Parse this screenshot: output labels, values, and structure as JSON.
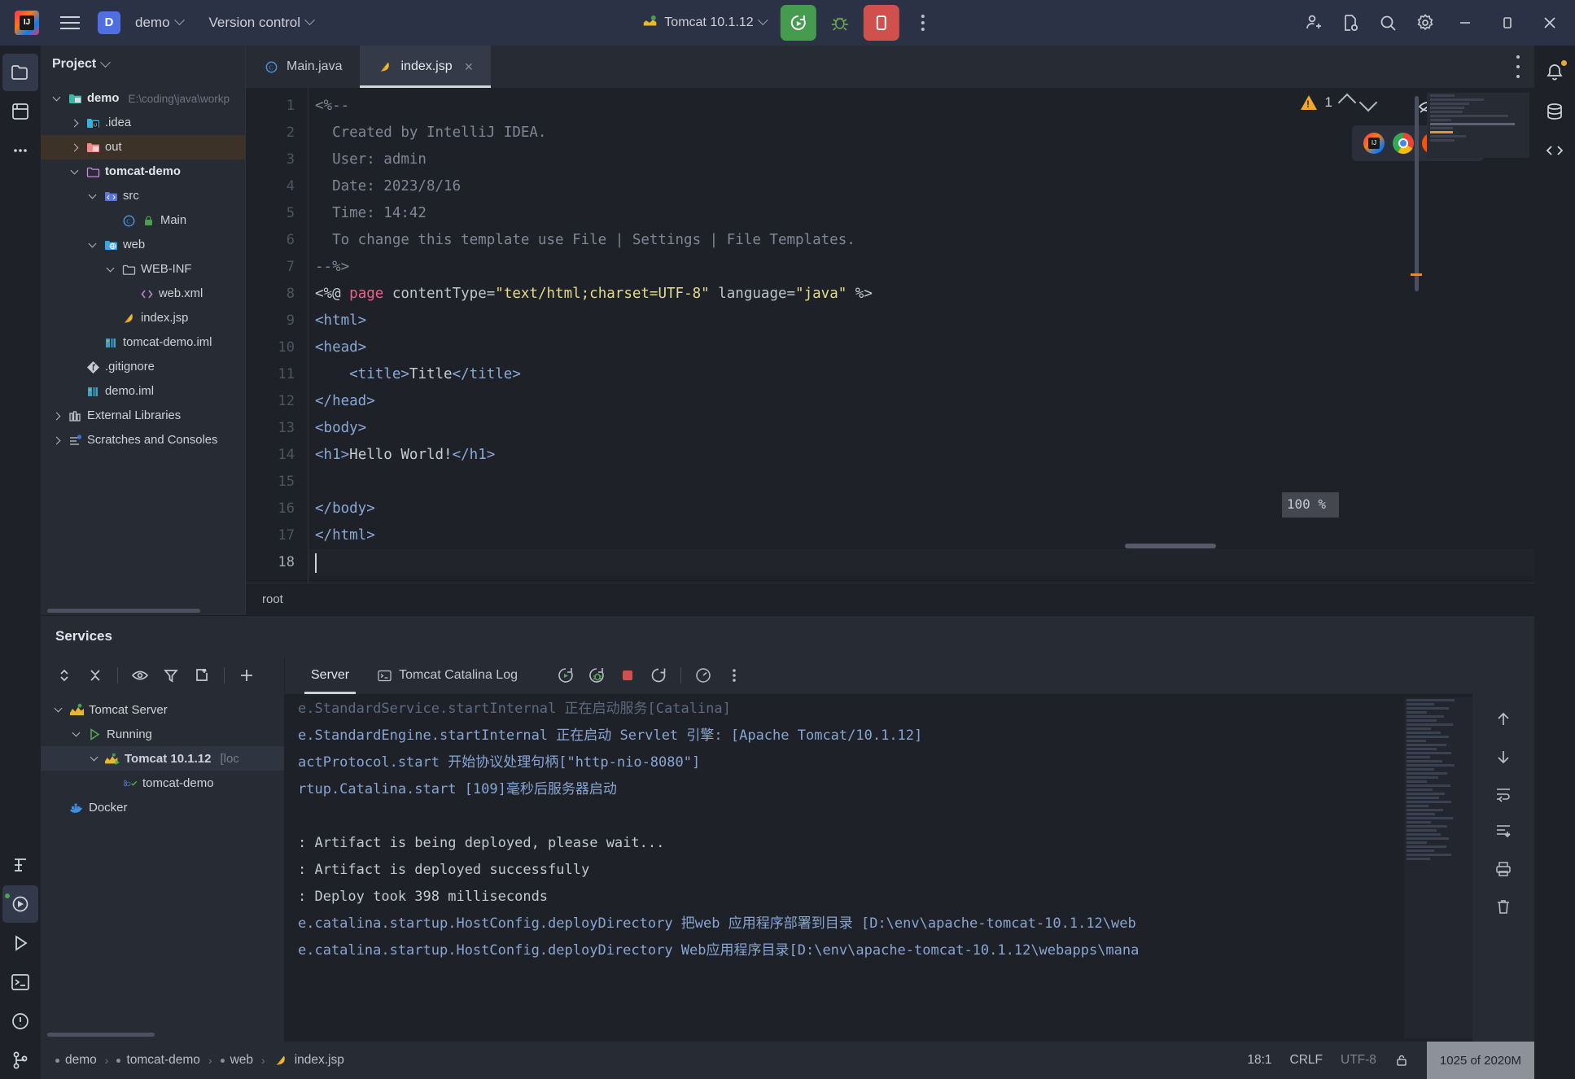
{
  "titlebar": {
    "menu_icon": "hamburger-icon",
    "project_badge": "D",
    "project_name": "demo",
    "version_control": "Version control",
    "run_config": "Tomcat 10.1.12",
    "run_icon": "run-rerun-icon",
    "debug_icon": "debug-bug-icon",
    "stop_icon": "stop-icon",
    "more_icon": "more-vertical-icon",
    "account_icon": "user-add-icon",
    "updates_icon": "file-settings-icon",
    "search_icon": "search-icon",
    "settings_icon": "gear-icon",
    "minimize": "minimize-icon",
    "maximize": "maximize-icon",
    "close": "close-icon"
  },
  "project_panel": {
    "title": "Project",
    "tree": [
      {
        "label": "demo",
        "path": "E:\\coding\\java\\workp",
        "indent": 0,
        "toggle": "down",
        "icon": "module-folder-icon",
        "bold": true,
        "state": "none"
      },
      {
        "label": ".idea",
        "path": "",
        "indent": 1,
        "toggle": "right",
        "icon": "idea-folder-icon",
        "bold": false,
        "state": "none"
      },
      {
        "label": "out",
        "path": "",
        "indent": 1,
        "toggle": "right",
        "icon": "excluded-folder-icon",
        "bold": false,
        "state": "selected-dim"
      },
      {
        "label": "tomcat-demo",
        "path": "",
        "indent": 1,
        "toggle": "down",
        "icon": "module-pink-icon",
        "bold": true,
        "state": "none"
      },
      {
        "label": "src",
        "path": "",
        "indent": 2,
        "toggle": "down",
        "icon": "source-folder-icon",
        "bold": false,
        "state": "none"
      },
      {
        "label": "Main",
        "path": "",
        "indent": 3,
        "toggle": "none",
        "icon": "java-class-icon",
        "bold": false,
        "state": "none"
      },
      {
        "label": "web",
        "path": "",
        "indent": 2,
        "toggle": "down",
        "icon": "web-folder-icon",
        "bold": false,
        "state": "none"
      },
      {
        "label": "WEB-INF",
        "path": "",
        "indent": 3,
        "toggle": "down",
        "icon": "folder-icon",
        "bold": false,
        "state": "none"
      },
      {
        "label": "web.xml",
        "path": "",
        "indent": 4,
        "toggle": "none",
        "icon": "xml-file-icon",
        "bold": false,
        "state": "none"
      },
      {
        "label": "index.jsp",
        "path": "",
        "indent": 3,
        "toggle": "none",
        "icon": "jsp-file-icon",
        "bold": false,
        "state": "none"
      },
      {
        "label": "tomcat-demo.iml",
        "path": "",
        "indent": 2,
        "toggle": "none",
        "icon": "iml-file-icon",
        "bold": false,
        "state": "none"
      },
      {
        "label": ".gitignore",
        "path": "",
        "indent": 1,
        "toggle": "none",
        "icon": "git-icon",
        "bold": false,
        "state": "none"
      },
      {
        "label": "demo.iml",
        "path": "",
        "indent": 1,
        "toggle": "none",
        "icon": "iml-file-icon",
        "bold": false,
        "state": "none"
      },
      {
        "label": "External Libraries",
        "path": "",
        "indent": 0,
        "toggle": "right",
        "icon": "library-icon",
        "bold": false,
        "state": "none"
      },
      {
        "label": "Scratches and Consoles",
        "path": "",
        "indent": 0,
        "toggle": "right",
        "icon": "scratches-icon",
        "bold": false,
        "state": "none"
      }
    ]
  },
  "editor": {
    "tabs": [
      {
        "label": "Main.java",
        "icon": "java-class-icon",
        "active": false,
        "closable": false
      },
      {
        "label": "index.jsp",
        "icon": "jsp-file-icon",
        "active": true,
        "closable": true
      }
    ],
    "inspection": {
      "warning_count": "1",
      "warning_icon": "warning-triangle-icon",
      "up_icon": "chevron-up-icon",
      "down_icon": "chevron-down-icon",
      "hide_icon": "hide-preview-icon"
    },
    "browsers": [
      "intellij-browser-icon",
      "chrome-icon",
      "firefox-icon",
      "edge-icon"
    ],
    "zoom_badge": "100 %",
    "breadcrumb": "root",
    "lines": [
      {
        "n": "1",
        "tokens": [
          {
            "t": "<%--",
            "c": "cmt"
          }
        ]
      },
      {
        "n": "2",
        "tokens": [
          {
            "t": "  Created by IntelliJ IDEA.",
            "c": "cmt"
          }
        ]
      },
      {
        "n": "3",
        "tokens": [
          {
            "t": "  User: admin",
            "c": "cmt"
          }
        ]
      },
      {
        "n": "4",
        "tokens": [
          {
            "t": "  Date: 2023/8/16",
            "c": "cmt"
          }
        ]
      },
      {
        "n": "5",
        "tokens": [
          {
            "t": "  Time: 14:42",
            "c": "cmt"
          }
        ]
      },
      {
        "n": "6",
        "tokens": [
          {
            "t": "  To change this template use File | Settings | File Templates.",
            "c": "cmt"
          }
        ]
      },
      {
        "n": "7",
        "tokens": [
          {
            "t": "--%>",
            "c": "cmt"
          }
        ]
      },
      {
        "n": "8",
        "tokens": [
          {
            "t": "<%@ ",
            "c": "del"
          },
          {
            "t": "page",
            "c": "kw"
          },
          {
            "t": " contentType=",
            "c": "attr"
          },
          {
            "t": "\"text/html;charset=UTF-8\"",
            "c": "str"
          },
          {
            "t": " language=",
            "c": "attr"
          },
          {
            "t": "\"java\"",
            "c": "str"
          },
          {
            "t": " %>",
            "c": "del"
          }
        ]
      },
      {
        "n": "9",
        "tokens": [
          {
            "t": "<html>",
            "c": "tag"
          }
        ]
      },
      {
        "n": "10",
        "tokens": [
          {
            "t": "<head>",
            "c": "tag"
          }
        ]
      },
      {
        "n": "11",
        "tokens": [
          {
            "t": "    <title>",
            "c": "tag"
          },
          {
            "t": "Title",
            "c": "txt"
          },
          {
            "t": "</title>",
            "c": "tag"
          }
        ]
      },
      {
        "n": "12",
        "tokens": [
          {
            "t": "</head>",
            "c": "tag"
          }
        ]
      },
      {
        "n": "13",
        "tokens": [
          {
            "t": "<body>",
            "c": "tag"
          }
        ]
      },
      {
        "n": "14",
        "tokens": [
          {
            "t": "<h1>",
            "c": "tag"
          },
          {
            "t": "Hello World!",
            "c": "txt"
          },
          {
            "t": "</h1>",
            "c": "tag"
          }
        ]
      },
      {
        "n": "15",
        "tokens": [
          {
            "t": "",
            "c": "txt"
          }
        ]
      },
      {
        "n": "16",
        "tokens": [
          {
            "t": "</body>",
            "c": "tag"
          }
        ]
      },
      {
        "n": "17",
        "tokens": [
          {
            "t": "</html>",
            "c": "tag"
          }
        ]
      },
      {
        "n": "18",
        "tokens": [
          {
            "t": "",
            "c": "txt"
          }
        ]
      }
    ]
  },
  "services": {
    "title": "Services",
    "toolbar": [
      {
        "icon": "expand-collapse-icon",
        "name": "expand-all-button"
      },
      {
        "icon": "collapse-all-icon",
        "name": "collapse-all-button"
      },
      {
        "icon": "eye-icon",
        "name": "show-options-button"
      },
      {
        "icon": "filter-icon",
        "name": "filter-button"
      },
      {
        "icon": "new-tab-icon",
        "name": "open-tab-button"
      },
      {
        "icon": "plus-icon",
        "name": "add-service-button"
      }
    ],
    "tree": [
      {
        "label": "Tomcat Server",
        "indent": 0,
        "toggle": "down",
        "icon": "tomcat-icon",
        "bold": false,
        "selected": false,
        "suffix": ""
      },
      {
        "label": "Running",
        "indent": 1,
        "toggle": "down",
        "icon": "run-triangle-icon",
        "bold": false,
        "selected": false,
        "suffix": ""
      },
      {
        "label": "Tomcat 10.1.12",
        "indent": 2,
        "toggle": "down",
        "icon": "tomcat-running-icon",
        "bold": true,
        "selected": true,
        "suffix": "[loc"
      },
      {
        "label": "tomcat-demo",
        "indent": 3,
        "toggle": "none",
        "icon": "artifact-ok-icon",
        "bold": false,
        "selected": false,
        "suffix": ""
      },
      {
        "label": "Docker",
        "indent": 0,
        "toggle": "none",
        "icon": "docker-icon",
        "bold": false,
        "selected": false,
        "suffix": ""
      }
    ],
    "tabs": [
      {
        "label": "Server",
        "icon": "",
        "active": true
      },
      {
        "label": "Tomcat Catalina Log",
        "icon": "console-icon",
        "active": false
      }
    ],
    "run_tools": [
      {
        "icon": "rerun-icon",
        "name": "rerun-button"
      },
      {
        "icon": "rerun-debug-icon",
        "name": "rerun-debug-button"
      },
      {
        "icon": "stop-icon",
        "name": "stop-button"
      },
      {
        "icon": "restart-icon",
        "name": "restart-button"
      },
      {
        "icon": "profiler-icon",
        "name": "profiler-button"
      },
      {
        "icon": "more-vertical-icon",
        "name": "more-button"
      }
    ],
    "side_tools": [
      {
        "icon": "arrow-up-icon",
        "name": "scroll-up-button"
      },
      {
        "icon": "arrow-down-icon",
        "name": "scroll-down-button"
      },
      {
        "icon": "soft-wrap-icon",
        "name": "soft-wrap-button"
      },
      {
        "icon": "scroll-to-end-icon",
        "name": "scroll-to-end-button"
      },
      {
        "icon": "print-icon",
        "name": "print-button"
      },
      {
        "icon": "trash-icon",
        "name": "clear-all-button"
      }
    ],
    "console_lines": [
      {
        "text": "e.StandardService.startInternal 正在启动服务[Catalina]",
        "style": "clip"
      },
      {
        "text": "e.StandardEngine.startInternal 正在启动 Servlet 引擎: [Apache Tomcat/10.1.12]",
        "style": "blue"
      },
      {
        "text": "actProtocol.start 开始协议处理句柄[\"http-nio-8080\"]",
        "style": "blue"
      },
      {
        "text": "rtup.Catalina.start [109]毫秒后服务器启动",
        "style": "blue"
      },
      {
        "text": "",
        "style": "blue"
      },
      {
        "text": ": Artifact is being deployed, please wait...",
        "style": "white"
      },
      {
        "text": ": Artifact is deployed successfully",
        "style": "white"
      },
      {
        "text": ": Deploy took 398 milliseconds",
        "style": "white"
      },
      {
        "text": "e.catalina.startup.HostConfig.deployDirectory 把web 应用程序部署到目录 [D:\\env\\apache-tomcat-10.1.12\\web",
        "style": "blue"
      },
      {
        "text": "e.catalina.startup.HostConfig.deployDirectory Web应用程序目录[D:\\env\\apache-tomcat-10.1.12\\webapps\\mana",
        "style": "blue"
      }
    ]
  },
  "statusbar": {
    "crumbs": [
      "demo",
      "tomcat-demo",
      "web",
      "index.jsp"
    ],
    "separator": "›",
    "caret_position": "18:1",
    "line_separator": "CRLF",
    "encoding": "UTF-8",
    "lock_icon": "read-only-lock-icon",
    "memory": "1025 of 2020M"
  },
  "left_stripe": [
    {
      "icon": "project-folder-icon",
      "name": "tool-window-project",
      "active": true
    },
    {
      "icon": "commit-icon",
      "name": "tool-window-commit",
      "active": false
    },
    {
      "icon": "more-dots-icon",
      "name": "tool-window-more",
      "active": false
    }
  ],
  "left_stripe_bottom": [
    {
      "icon": "structure-icon",
      "name": "tool-window-structure"
    },
    {
      "icon": "services-icon",
      "name": "tool-window-services",
      "active": true
    },
    {
      "icon": "run-icon",
      "name": "tool-window-run"
    },
    {
      "icon": "terminal-icon",
      "name": "tool-window-terminal"
    },
    {
      "icon": "problems-icon",
      "name": "tool-window-problems"
    },
    {
      "icon": "git-branch-icon",
      "name": "tool-window-git"
    }
  ],
  "right_stripe": [
    {
      "icon": "notifications-bell-icon",
      "name": "tool-window-notifications"
    },
    {
      "icon": "database-icon",
      "name": "tool-window-database"
    },
    {
      "icon": "code-with-me-icon",
      "name": "tool-window-code-with-me"
    }
  ],
  "colors": {
    "accent_green": "#459c4e",
    "accent_red": "#d0504e",
    "warning": "#f0a732",
    "titlebar_bg": "#2b3245",
    "panel_bg": "#272b33",
    "editor_bg": "#1e2128"
  }
}
